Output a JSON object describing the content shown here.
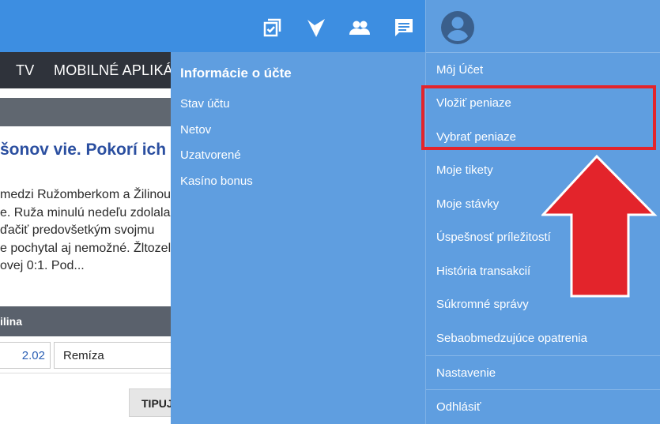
{
  "nav": {
    "tv": "TV",
    "apps": "MOBILNÉ APLIKÁCIE"
  },
  "article": {
    "headline": "šonov vie. Pokorí ich",
    "lines": [
      "medzi Ružomberkom a Žilinou",
      "e. Ruža minulú nedeľu zdolala",
      "ďačiť predovšetkým svojmu",
      "e pochytal aj nemožné. Žltozelení",
      "ovej 0:1. Pod..."
    ]
  },
  "odds": {
    "header": "ilina",
    "value": "2.02",
    "draw_label": "Remíza",
    "tip_button": "TIPUJ"
  },
  "account_panel": {
    "title": "Informácie o účte",
    "items": [
      "Stav účtu",
      "Netov",
      "Uzatvorené",
      "Kasíno bonus"
    ]
  },
  "user_menu": {
    "my_account": "Môj Účet",
    "deposit": "Vložiť peniaze",
    "withdraw": "Vybrať peniaze",
    "my_tickets": "Moje tikety",
    "my_bets": "Moje stávky",
    "success": "Úspešnosť príležitostí",
    "history": "História transakcií",
    "messages": "Súkromné správy",
    "self_limits": "Sebaobmedzujúce opatrenia",
    "settings": "Nastavenie",
    "logout": "Odhlásiť"
  },
  "icons": {
    "tickets": "tickets-icon",
    "bet_check": "bet-check-icon",
    "friends": "people-icon",
    "chat": "chat-icon",
    "account": "account-circle-icon"
  },
  "colors": {
    "topbar": "#3d8ee1",
    "panel": "#5f9ee0",
    "navbar": "#2f333b",
    "highlight": "#e3242b"
  }
}
